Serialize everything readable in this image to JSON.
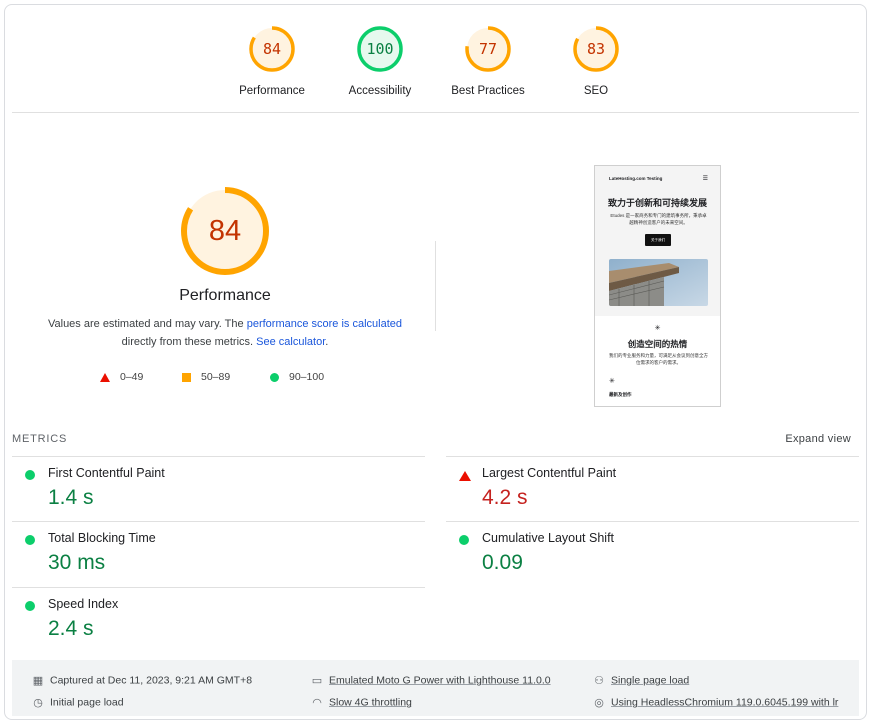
{
  "colors": {
    "average": "#ffa400",
    "good": "#0cce6b",
    "poor": "#eb0f00",
    "link": "#1a56db"
  },
  "scores": [
    {
      "label": "Performance",
      "value": "84",
      "fraction": 0.84,
      "rating": "average"
    },
    {
      "label": "Accessibility",
      "value": "100",
      "fraction": 1.0,
      "rating": "good"
    },
    {
      "label": "Best Practices",
      "value": "77",
      "fraction": 0.77,
      "rating": "average"
    },
    {
      "label": "SEO",
      "value": "83",
      "fraction": 0.83,
      "rating": "average"
    }
  ],
  "performance": {
    "score": "84",
    "fraction": 0.84,
    "title": "Performance",
    "desc_prefix": "Values are estimated and may vary. The ",
    "desc_link1": "performance score is calculated",
    "desc_middle": " directly from these metrics. ",
    "desc_link2": "See calculator",
    "desc_suffix": "."
  },
  "legend": {
    "poor": "0–49",
    "average": "50–89",
    "good": "90–100"
  },
  "thumbnail": {
    "brand": "LateHosting.com Testing",
    "menu_icon": "menu-icon",
    "heading": "致力于创新和可持续发展",
    "paragraph": "Etudes 是一家商务和专门的建筑事务所，秉承卓越精神创造客户的未来空间。",
    "button": "关于我们",
    "heading2": "创造空间的热情",
    "paragraph2": "我们的专业服务和力量，可满足从会议到创意全方位需求的客户的需求。",
    "heading3": "最新及创作"
  },
  "metrics_section": {
    "title": "METRICS",
    "expand": "Expand view",
    "items": [
      {
        "name": "First Contentful Paint",
        "value": "1.4 s",
        "rating": "good"
      },
      {
        "name": "Largest Contentful Paint",
        "value": "4.2 s",
        "rating": "poor"
      },
      {
        "name": "Total Blocking Time",
        "value": "30 ms",
        "rating": "good"
      },
      {
        "name": "Cumulative Layout Shift",
        "value": "0.09",
        "rating": "good"
      },
      {
        "name": "Speed Index",
        "value": "2.4 s",
        "rating": "good"
      }
    ]
  },
  "environment": {
    "captured": "Captured at Dec 11, 2023, 9:21 AM GMT+8",
    "device": "Emulated Moto G Power with Lighthouse 11.0.0",
    "session": "Single page load",
    "initial": "Initial page load",
    "throttling": "Slow 4G throttling",
    "browser": "Using HeadlessChromium 119.0.6045.199 with lr"
  }
}
